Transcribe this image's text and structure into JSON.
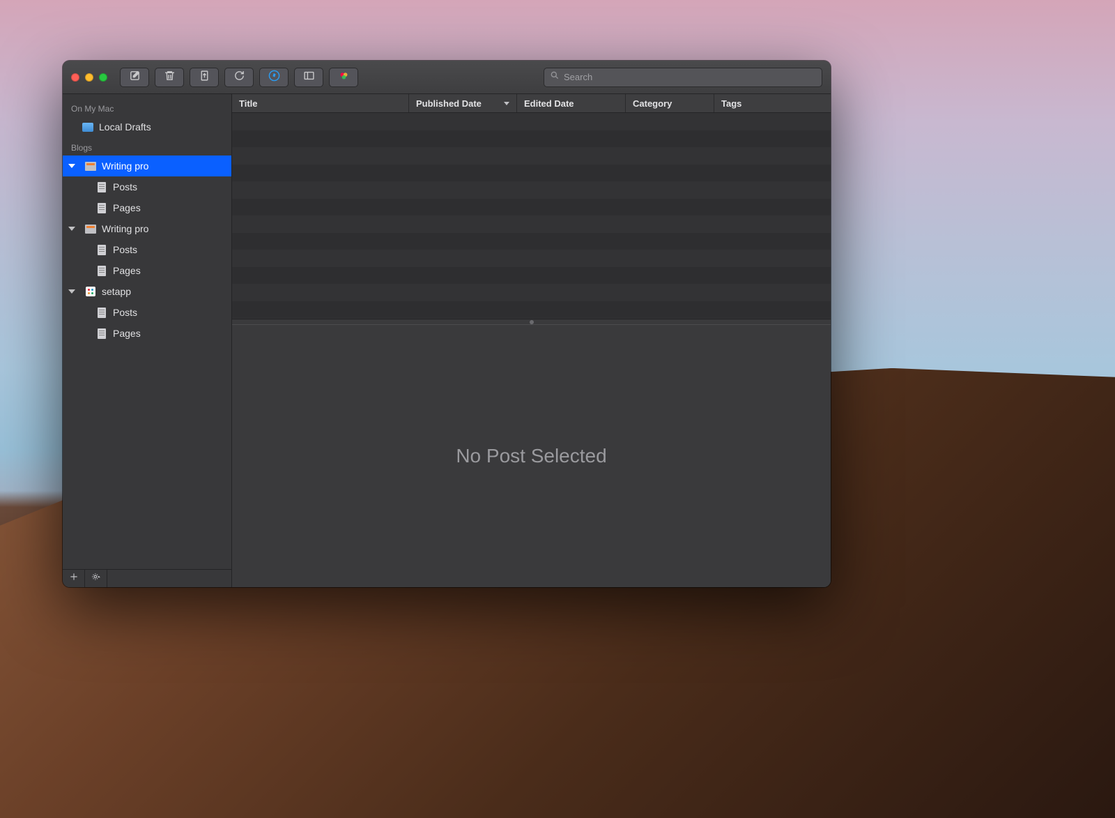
{
  "search": {
    "placeholder": "Search"
  },
  "sidebar": {
    "sections": [
      {
        "header": "On My Mac",
        "items": [
          {
            "label": "Local Drafts",
            "icon": "folder"
          }
        ]
      },
      {
        "header": "Blogs",
        "items": [
          {
            "label": "Writing pro",
            "icon": "blog",
            "expanded": true,
            "selected": true,
            "children": [
              {
                "label": "Posts",
                "icon": "doc"
              },
              {
                "label": "Pages",
                "icon": "doc"
              }
            ]
          },
          {
            "label": "Writing pro",
            "icon": "blog",
            "expanded": true,
            "children": [
              {
                "label": "Posts",
                "icon": "doc"
              },
              {
                "label": "Pages",
                "icon": "doc"
              }
            ]
          },
          {
            "label": "setapp",
            "icon": "setapp",
            "expanded": true,
            "children": [
              {
                "label": "Posts",
                "icon": "doc"
              },
              {
                "label": "Pages",
                "icon": "doc"
              }
            ]
          }
        ]
      }
    ]
  },
  "columns": {
    "title": "Title",
    "published": "Published Date",
    "edited": "Edited Date",
    "category": "Category",
    "tags": "Tags",
    "sorted_by": "published"
  },
  "preview": {
    "empty_text": "No Post Selected"
  }
}
